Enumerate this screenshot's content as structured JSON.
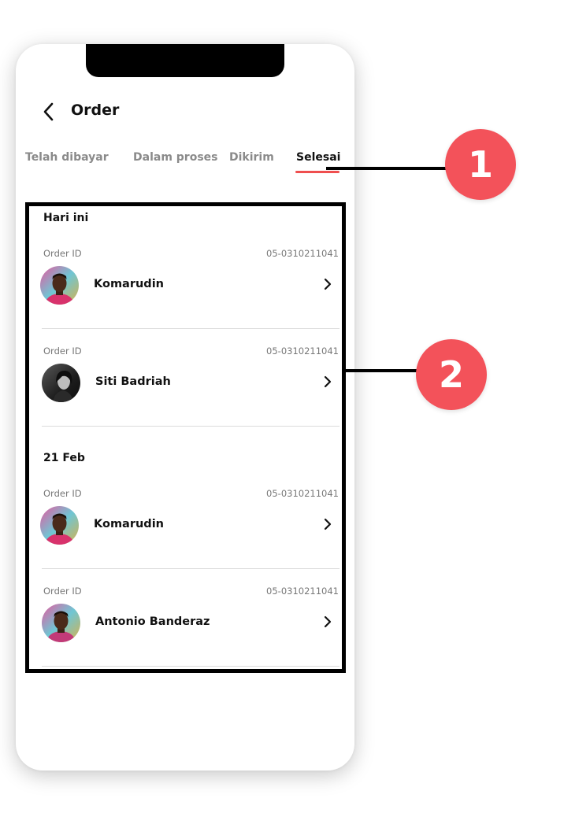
{
  "header": {
    "title": "Order"
  },
  "tabs": [
    {
      "label": "Telah dibayar",
      "active": false
    },
    {
      "label": "Dalam proses",
      "active": false
    },
    {
      "label": "Dikirim",
      "active": false
    },
    {
      "label": "Selesai",
      "active": true
    }
  ],
  "sections": [
    {
      "label": "Hari ini",
      "orders": [
        {
          "order_id_label": "Order ID",
          "order_id": "05-0310211041",
          "name": "Komarudin",
          "avatar": "avatar-colorful-man"
        },
        {
          "order_id_label": "Order ID",
          "order_id": "05-0310211041",
          "name": "Siti Badriah",
          "avatar": "avatar-bw-woman"
        }
      ]
    },
    {
      "label": "21 Feb",
      "orders": [
        {
          "order_id_label": "Order ID",
          "order_id": "05-0310211041",
          "name": "Komarudin",
          "avatar": "avatar-colorful-man"
        },
        {
          "order_id_label": "Order ID",
          "order_id": "05-0310211041",
          "name": "Antonio Banderaz",
          "avatar": "avatar-colorful-man"
        }
      ]
    }
  ],
  "annotations": [
    {
      "number": "1"
    },
    {
      "number": "2"
    }
  ],
  "colors": {
    "accent": "#ef4f4f",
    "badge": "#f3525a"
  },
  "icons": {
    "back": "chevron-left-icon",
    "row": "chevron-right-icon"
  }
}
